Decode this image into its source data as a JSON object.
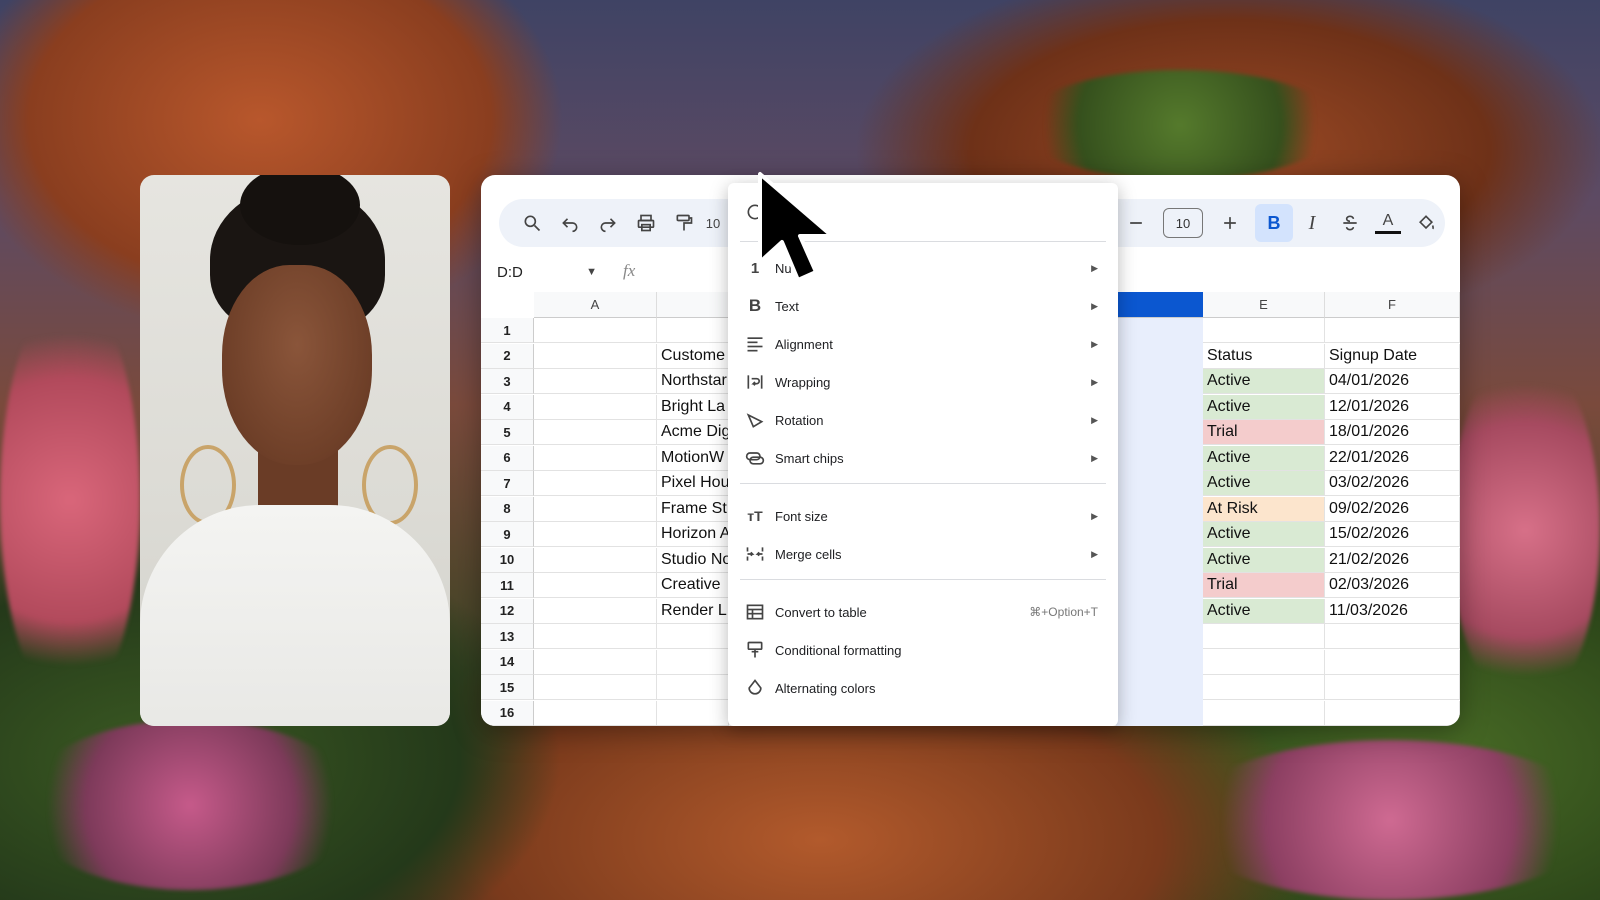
{
  "toolbar": {
    "zoom_partial": "10",
    "font_size": "10",
    "icons": [
      "search-icon",
      "undo-icon",
      "redo-icon",
      "print-icon",
      "paint-format-icon",
      "minus-icon",
      "plus-icon",
      "bold-icon",
      "italic-icon",
      "strikethrough-icon",
      "text-color-icon",
      "fill-color-icon"
    ]
  },
  "namebox": {
    "value": "D:D"
  },
  "formula": {
    "fx": "fx"
  },
  "grid": {
    "columns": [
      "A",
      "",
      "",
      "E",
      "F"
    ],
    "rows": [
      "1",
      "2",
      "3",
      "4",
      "5",
      "6",
      "7",
      "8",
      "9",
      "10",
      "11",
      "12",
      "13",
      "14",
      "15",
      "16"
    ],
    "colB": [
      "",
      "Custome",
      "Northstar",
      "Bright La",
      "Acme Dig",
      "MotionW",
      "Pixel Hou",
      "Frame St",
      "Horizon A",
      "Studio No",
      "Creative",
      "Render L"
    ],
    "colE": [
      "",
      "Status",
      "Active",
      "Active",
      "Trial",
      "Active",
      "Active",
      "At Risk",
      "Active",
      "Active",
      "Trial",
      "Active"
    ],
    "colF": [
      "",
      "Signup Date",
      "04/01/2026",
      "12/01/2026",
      "18/01/2026",
      "22/01/2026",
      "03/02/2026",
      "09/02/2026",
      "15/02/2026",
      "21/02/2026",
      "02/03/2026",
      "11/03/2026"
    ],
    "status_colors": {
      "Active": "#d9ead3",
      "Trial": "#f4cccc",
      "At Risk": "#fce5cd"
    }
  },
  "menu": {
    "partial_top": "?",
    "items": [
      {
        "label": "Nu",
        "icon": "number-format-icon",
        "submenu": true
      },
      {
        "label": "Text",
        "icon": "bold-b-icon",
        "submenu": true
      },
      {
        "label": "Alignment",
        "icon": "align-icon",
        "submenu": true
      },
      {
        "label": "Wrapping",
        "icon": "wrap-icon",
        "submenu": true
      },
      {
        "label": "Rotation",
        "icon": "rotation-icon",
        "submenu": true
      },
      {
        "label": "Smart chips",
        "icon": "smart-chips-icon",
        "submenu": true
      },
      {
        "label": "Font size",
        "icon": "font-size-icon",
        "submenu": true
      },
      {
        "label": "Merge cells",
        "icon": "merge-icon",
        "submenu": true
      },
      {
        "label": "Convert to table",
        "icon": "table-icon",
        "shortcut": "⌘+Option+T"
      },
      {
        "label": "Conditional formatting",
        "icon": "conditional-format-icon"
      },
      {
        "label": "Alternating colors",
        "icon": "alternating-colors-icon"
      }
    ]
  }
}
